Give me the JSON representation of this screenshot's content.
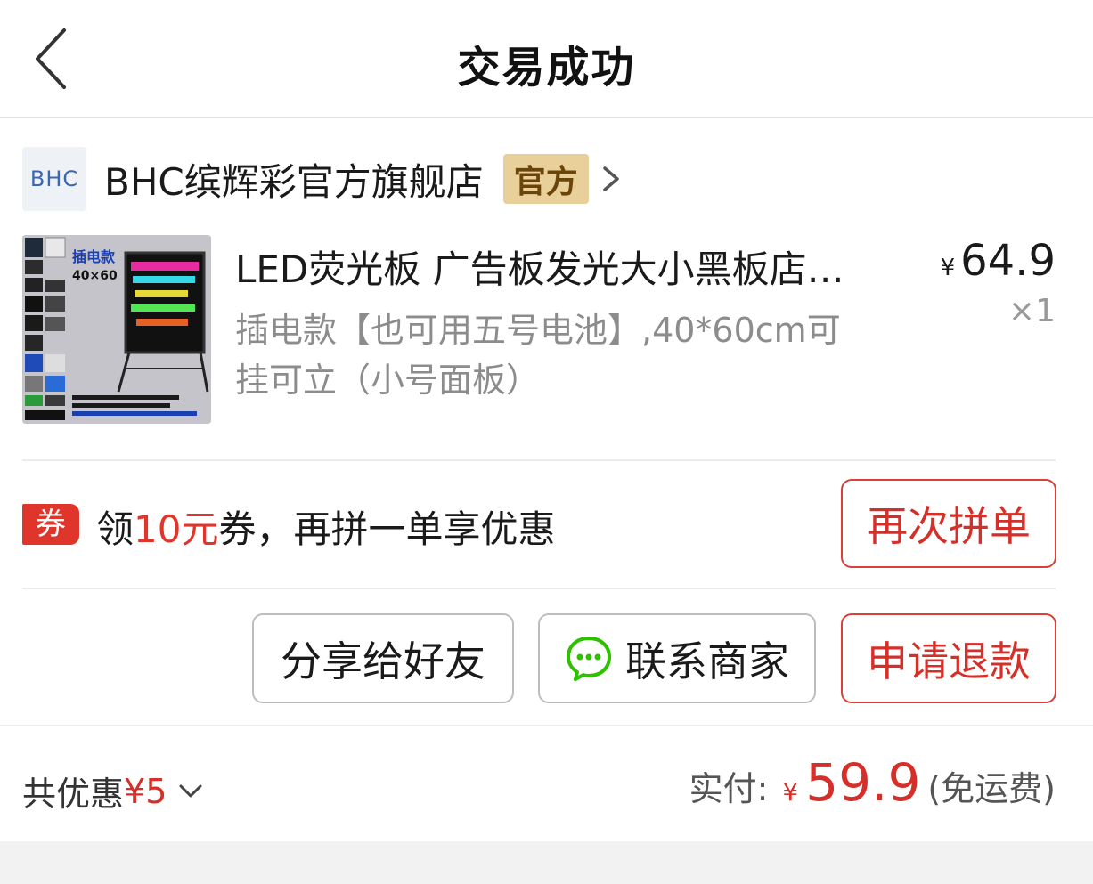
{
  "header": {
    "title": "交易成功"
  },
  "store": {
    "logo_text": "BHC",
    "name": "BHC缤辉彩官方旗舰店",
    "badge": "官方"
  },
  "product": {
    "image_labels": {
      "plug_label": "插电款",
      "size_label": "40×60"
    },
    "title": "LED荧光板 广告板发光大小黑板店…",
    "spec_line1": "插电款【也可用五号电池】,40*60cm可",
    "spec_line2": "挂可立（小号面板）",
    "price_currency": "¥",
    "price": "64.9",
    "quantity": "×1"
  },
  "coupon": {
    "badge": "券",
    "text_prefix": "领",
    "amount": "10元",
    "text_suffix": "券，再拼一单享优惠",
    "reorder_label": "再次拼单"
  },
  "actions": {
    "share_label": "分享给好友",
    "contact_label": "联系商家",
    "refund_label": "申请退款"
  },
  "summary": {
    "discount_label": "共优惠",
    "discount_amount": "¥5",
    "paid_label": "实付:",
    "paid_currency": "¥",
    "paid_amount": "59.9",
    "paid_note": "(免运费)"
  },
  "colors": {
    "accent_red": "#d42f28",
    "badge_gold": "#e9cf9a",
    "wechat_green": "#2dc100"
  }
}
